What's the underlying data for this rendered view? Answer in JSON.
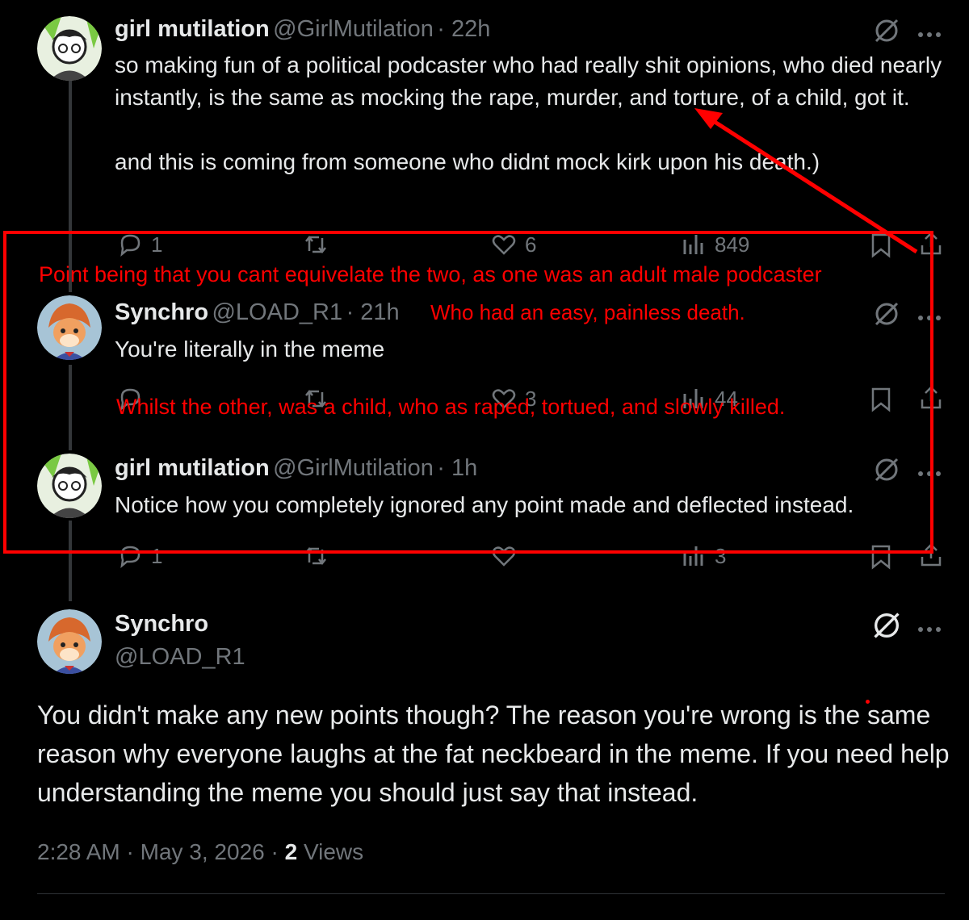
{
  "colors": {
    "background": "#000000",
    "text": "#e7e9ea",
    "muted": "#71767b",
    "annotation": "#ff0000"
  },
  "posts": [
    {
      "name": "girl mutilation",
      "handle": "@GirlMutilation",
      "time": "· 22h",
      "text": "so making fun of a political podcaster who had really shit opinions, who died nearly instantly, is the same as mocking the rape, murder, and torture, of a child, got it.\n\nand this is coming from someone who didnt mock kirk upon his death.)",
      "replies": "1",
      "reposts": "",
      "likes": "6",
      "views": "849"
    },
    {
      "name": "Synchro",
      "handle": "@LOAD_R1",
      "time": "· 21h",
      "text": "You're literally in the meme",
      "replies": "",
      "reposts": "",
      "likes": "3",
      "views": "44"
    },
    {
      "name": "girl mutilation",
      "handle": "@GirlMutilation",
      "time": "· 1h",
      "text": "Notice how you completely ignored any point made and deflected instead.",
      "replies": "1",
      "reposts": "",
      "likes": "",
      "views": "3"
    }
  ],
  "main_post": {
    "name": "Synchro",
    "handle": "@LOAD_R1",
    "text": "You didn't make any new points though? The reason you're wrong is the same reason why everyone laughs at the fat neckbeard in the meme. If you need help understanding the meme you should just say that instead.",
    "timestamp": "2:28 AM · May 3, 2026 · ",
    "views_count": "2",
    "views_label": " Views"
  },
  "annotations": {
    "line1": "Point being that you cant equivelate the two, as one was an adult male podcaster",
    "line2": "Who had an easy, painless death.",
    "line3": "Whilst the other, was a child, who as raped, tortued, and slowly killed."
  }
}
